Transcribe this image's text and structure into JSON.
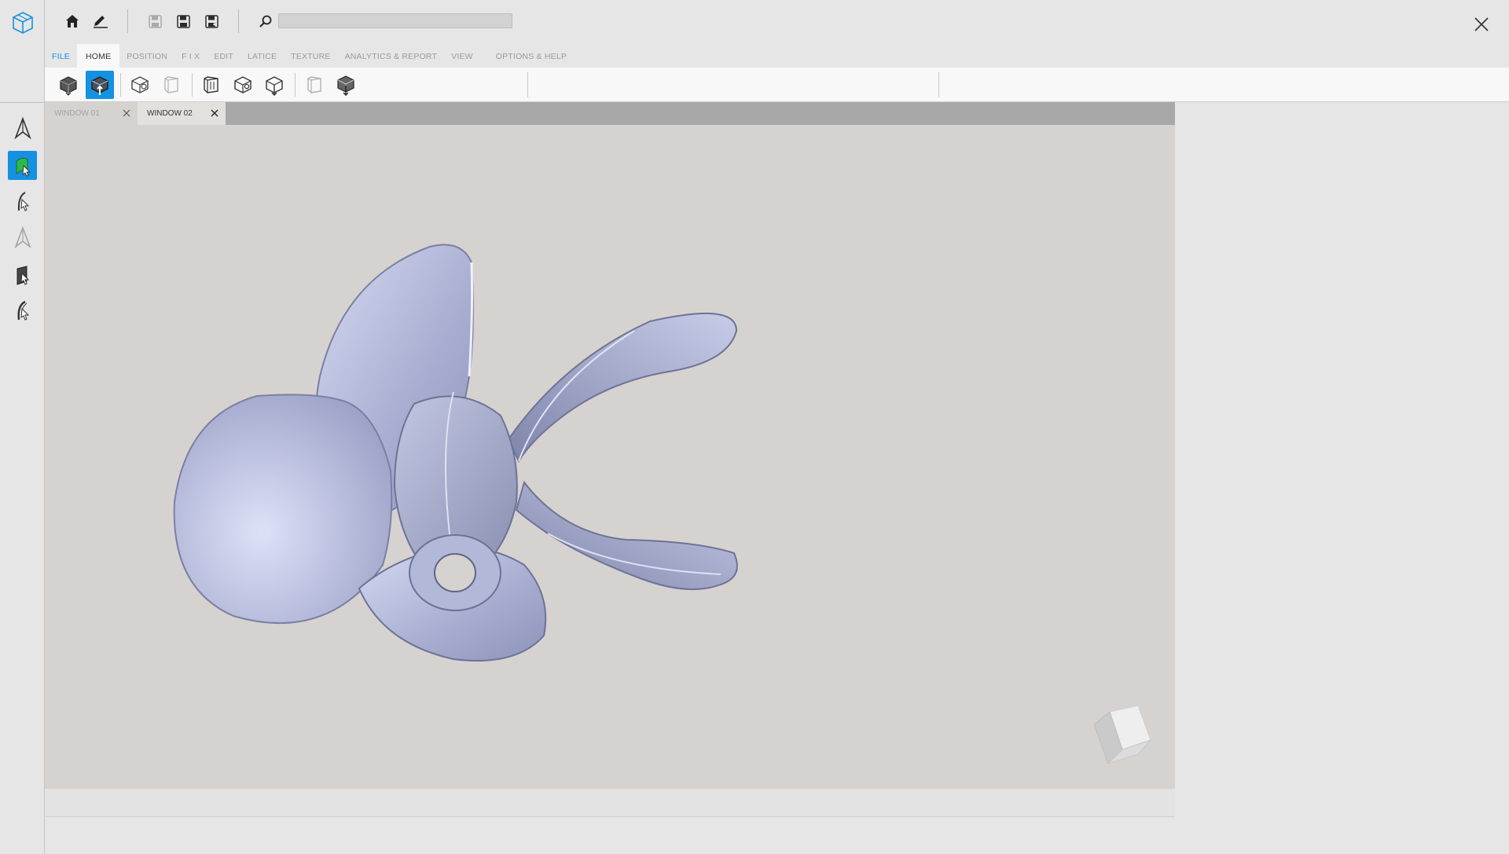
{
  "menu": {
    "items": [
      {
        "id": "file",
        "label": "FILE"
      },
      {
        "id": "home",
        "label": "HOME"
      },
      {
        "id": "position",
        "label": "POSITION"
      },
      {
        "id": "fix",
        "label": "F I X"
      },
      {
        "id": "edit",
        "label": "EDIT"
      },
      {
        "id": "latice",
        "label": "LATICE"
      },
      {
        "id": "texture",
        "label": "TEXTURE"
      },
      {
        "id": "analytics",
        "label": "ANALYTICS & REPORT"
      },
      {
        "id": "view",
        "label": "VIEW"
      },
      {
        "id": "options",
        "label": "OPTIONS & HELP"
      }
    ],
    "active": "HOME"
  },
  "tabs": [
    {
      "label": "WINDOW 01",
      "active": false
    },
    {
      "label": "WINDOW 02",
      "active": true
    }
  ],
  "search": {
    "placeholder": ""
  },
  "colors": {
    "accent": "#1591e1",
    "active_tool_fill": "#2db84a",
    "viewport_bg": "#d6d2cf",
    "model": "#a9afd3"
  },
  "icons": {
    "top": [
      "home-icon",
      "pencil-icon",
      "save-disabled-icon",
      "save-icon",
      "save-as-icon",
      "search-icon"
    ],
    "left_tools": [
      "arrow-select-icon",
      "surface-select-icon",
      "edge-select-icon",
      "vertex-select-icon",
      "face-select-icon",
      "body-select-icon"
    ],
    "ribbon": [
      "import-cube-icon",
      "export-cube-icon",
      "open-cube-icon",
      "cube-disabled-icon",
      "cube-front-icon",
      "cube-side-icon",
      "cube-up-icon",
      "cube-ghost-icon",
      "cube-download-icon"
    ]
  }
}
